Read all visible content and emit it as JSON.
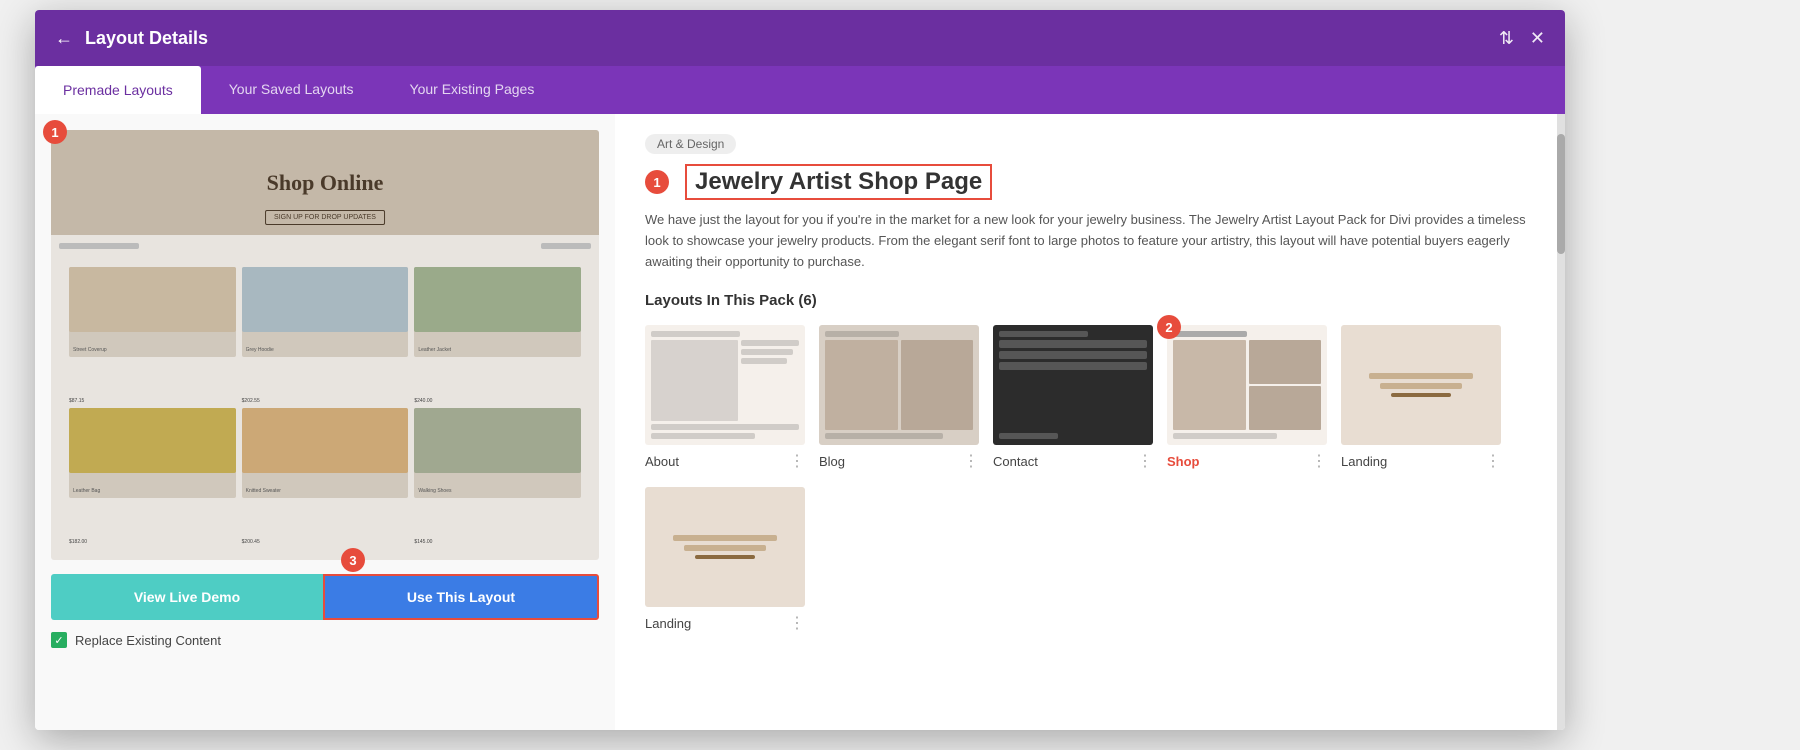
{
  "modal": {
    "title": "Layout Details",
    "back_icon": "←",
    "settings_icon": "⇅",
    "close_icon": "✕"
  },
  "tabs": [
    {
      "id": "premade",
      "label": "Premade Layouts",
      "active": true
    },
    {
      "id": "saved",
      "label": "Your Saved Layouts",
      "active": false
    },
    {
      "id": "existing",
      "label": "Your Existing Pages",
      "active": false
    }
  ],
  "preview": {
    "hero_text": "Shop Online",
    "hero_btn": "SIGN UP FOR DROP UPDATES",
    "grid_items": [
      {
        "label": "Street Coverup",
        "price": "$87.15"
      },
      {
        "label": "Grey Hoodie",
        "price": "$202.55"
      },
      {
        "label": "Leather Jacket",
        "price": "$240.00"
      },
      {
        "label": "Leather Bag",
        "price": "$182.00"
      },
      {
        "label": "Knitted Sweater",
        "price": "$200.45"
      },
      {
        "label": "Walking Shoes",
        "price": "$145.00"
      }
    ],
    "btn_demo": "View Live Demo",
    "btn_use": "Use This Layout",
    "replace_label": "Replace Existing Content",
    "badge_1": "1",
    "badge_3": "3"
  },
  "detail": {
    "category": "Art & Design",
    "title": "Jewelry Artist Shop Page",
    "description": "We have just the layout for you if you're in the market for a new look for your jewelry business. The Jewelry Artist Layout Pack for Divi provides a timeless look to showcase your jewelry products. From the elegant serif font to large photos to feature your artistry, this layout will have potential buyers eagerly awaiting their opportunity to purchase.",
    "pack_label": "Layouts In This Pack (6)",
    "badge_2": "2",
    "layouts": [
      {
        "id": "about",
        "name": "About",
        "highlighted": false,
        "theme": "light"
      },
      {
        "id": "blog",
        "name": "Blog",
        "highlighted": false,
        "theme": "light"
      },
      {
        "id": "contact",
        "name": "Contact",
        "highlighted": false,
        "theme": "dark"
      },
      {
        "id": "shop",
        "name": "Shop",
        "highlighted": true,
        "theme": "light"
      },
      {
        "id": "landing",
        "name": "Landing",
        "highlighted": false,
        "theme": "warm"
      }
    ],
    "bottom_layouts": [
      {
        "id": "landing2",
        "name": "Landing",
        "highlighted": false,
        "theme": "warm"
      }
    ]
  }
}
